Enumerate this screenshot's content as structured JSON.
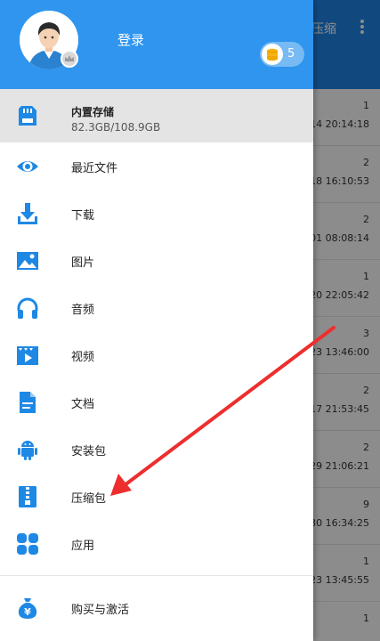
{
  "background_app": {
    "title": "压缩",
    "rows": [
      {
        "count": "1",
        "time": "-14 20:14:18"
      },
      {
        "count": "2",
        "time": "-18 16:10:53"
      },
      {
        "count": "2",
        "time": "01 08:08:14"
      },
      {
        "count": "1",
        "time": "20 22:05:42"
      },
      {
        "count": "3",
        "time": "23 13:46:00"
      },
      {
        "count": "2",
        "time": "-17 21:53:45"
      },
      {
        "count": "2",
        "time": "-29 21:06:21"
      },
      {
        "count": "9",
        "time": "30 16:34:25"
      },
      {
        "count": "1",
        "time": "23 13:45:55"
      },
      {
        "count": "1",
        "time": ""
      }
    ]
  },
  "drawer": {
    "login_label": "登录",
    "coins": "5",
    "storage": {
      "name": "内置存储",
      "size": "82.3GB/108.9GB"
    },
    "items": [
      {
        "label": "最近文件",
        "icon": "eye-icon"
      },
      {
        "label": "下载",
        "icon": "download-icon"
      },
      {
        "label": "图片",
        "icon": "image-icon"
      },
      {
        "label": "音频",
        "icon": "headphones-icon"
      },
      {
        "label": "视频",
        "icon": "video-icon"
      },
      {
        "label": "文档",
        "icon": "document-icon"
      },
      {
        "label": "安装包",
        "icon": "android-icon"
      },
      {
        "label": "压缩包",
        "icon": "zip-icon"
      },
      {
        "label": "应用",
        "icon": "apps-icon"
      }
    ],
    "purchase_label": "购买与激活"
  },
  "colors": {
    "accent": "#1f86e8",
    "drawer_header": "#2f95ee",
    "icon": "#1e88e5",
    "arrow": "#ee2e2e"
  }
}
